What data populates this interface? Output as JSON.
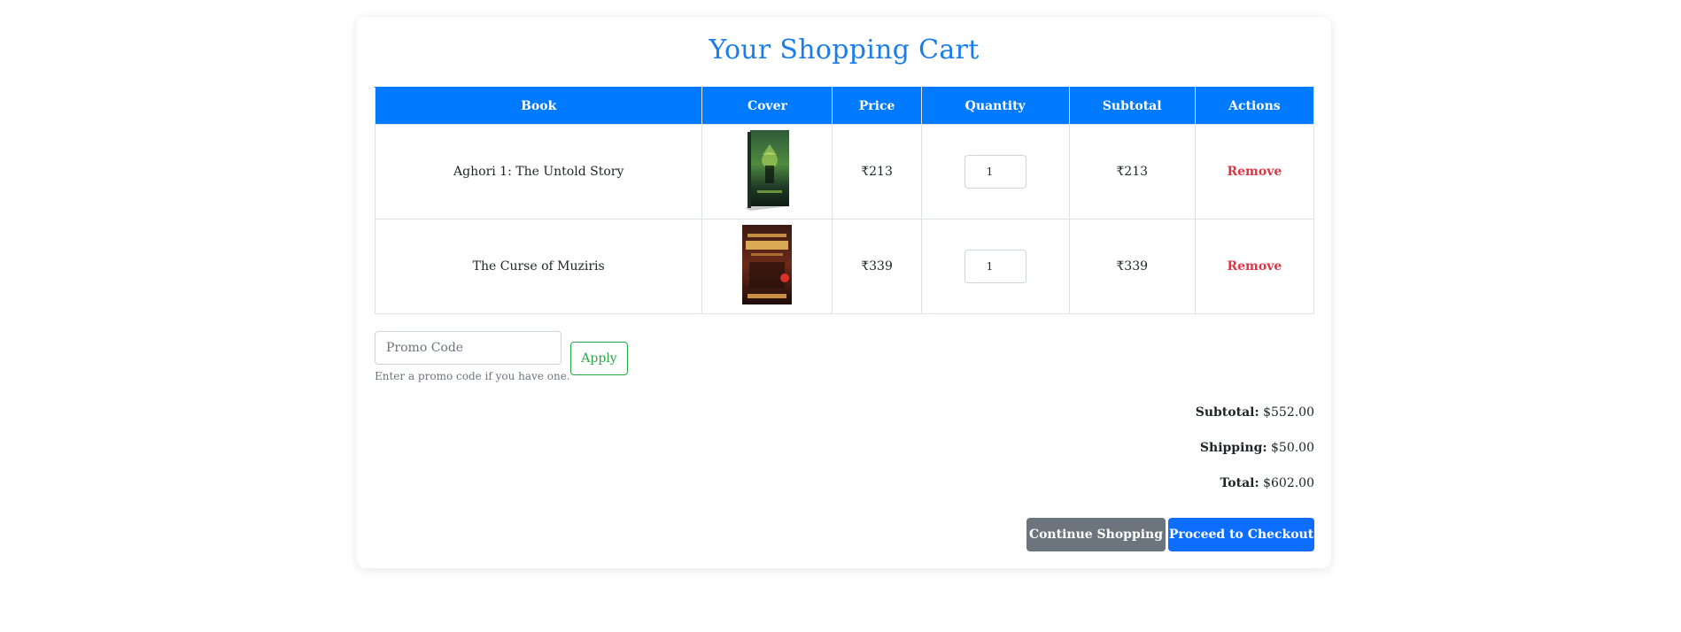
{
  "page": {
    "title": "Your Shopping Cart"
  },
  "table": {
    "headers": [
      "Book",
      "Cover",
      "Price",
      "Quantity",
      "Subtotal",
      "Actions"
    ],
    "rows": [
      {
        "book": "Aghori 1: The Untold Story",
        "cover_icon": "book-cover-aghori",
        "price": "₹213",
        "quantity": "1",
        "subtotal": "₹213",
        "action": "Remove"
      },
      {
        "book": "The Curse of Muziris",
        "cover_icon": "book-cover-muziris",
        "price": "₹339",
        "quantity": "1",
        "subtotal": "₹339",
        "action": "Remove"
      }
    ]
  },
  "promo": {
    "placeholder": "Promo Code",
    "help": "Enter a promo code if you have one.",
    "apply_label": "Apply"
  },
  "summary": {
    "subtotal_label": "Subtotal:",
    "subtotal_value": "$552.00",
    "shipping_label": "Shipping:",
    "shipping_value": "$50.00",
    "total_label": "Total:",
    "total_value": "$602.00"
  },
  "buttons": {
    "continue_label": "Continue Shopping",
    "checkout_label": "Proceed to Checkout"
  },
  "colors": {
    "accent": "#007bff",
    "title": "#1a7de8",
    "remove": "#dc3545",
    "apply": "#28a745",
    "secondary": "#6c757d",
    "primary": "#0d6efd"
  }
}
